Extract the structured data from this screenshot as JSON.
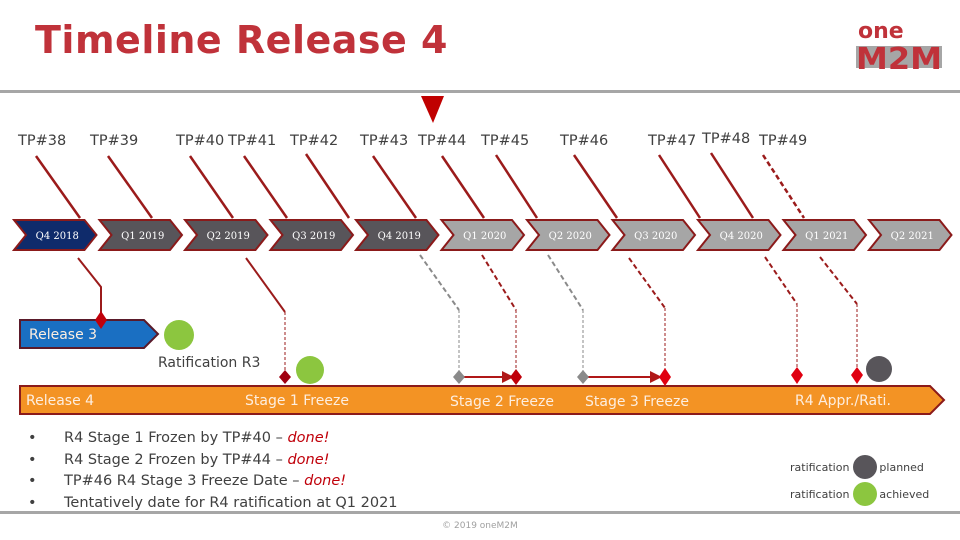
{
  "header": {
    "title": "Timeline Release 4",
    "logo_top": "one",
    "logo_bottom": "M2M"
  },
  "colors": {
    "title": "#c0323a",
    "chevron_past": "#58555a",
    "chevron_current": "#0f2b6b",
    "chevron_future": "#a6a6a6",
    "chevron_border": "#8b1a1a",
    "release3": "#1a6fc2",
    "release4": "#f39324",
    "achieved": "#8cc63f",
    "planned": "#58555a",
    "marker": "#c00000"
  },
  "current_marker": "TP#44",
  "tp_meetings": [
    "TP#38",
    "TP#39",
    "TP#40",
    "TP#41",
    "TP#42",
    "TP#43",
    "TP#44",
    "TP#45",
    "TP#46",
    "TP#47",
    "TP#48",
    "TP#49"
  ],
  "quarters": [
    {
      "label": "Q4 2018",
      "state": "current"
    },
    {
      "label": "Q1 2019",
      "state": "past"
    },
    {
      "label": "Q2 2019",
      "state": "past"
    },
    {
      "label": "Q3 2019",
      "state": "past"
    },
    {
      "label": "Q4 2019",
      "state": "past"
    },
    {
      "label": "Q1 2020",
      "state": "future"
    },
    {
      "label": "Q2 2020",
      "state": "future"
    },
    {
      "label": "Q3 2020",
      "state": "future"
    },
    {
      "label": "Q4 2020",
      "state": "future"
    },
    {
      "label": "Q1 2021",
      "state": "future"
    },
    {
      "label": "Q2 2021",
      "state": "future"
    }
  ],
  "release3": {
    "label": "Release 3",
    "ratification_label": "Ratification R3"
  },
  "release4": {
    "label": "Release 4",
    "milestones": [
      "Stage 1 Freeze",
      "Stage 2 Freeze",
      "Stage 3 Freeze",
      "R4 Appr./Rati."
    ]
  },
  "bullets": [
    {
      "text": "R4 Stage 1 Frozen by TP#40 – ",
      "status": "done!"
    },
    {
      "text": "R4 Stage 2 Frozen by TP#44 – ",
      "status": "done!"
    },
    {
      "text": "TP#46 R4 Stage 3 Freeze Date  – ",
      "status": "done!"
    },
    {
      "text": "Tentatively date for R4 ratification at Q1 2021",
      "status": ""
    }
  ],
  "legend": [
    {
      "left": "ratification",
      "right": "planned",
      "color": "#58555a"
    },
    {
      "left": "ratification",
      "right": "achieved",
      "color": "#8cc63f"
    }
  ],
  "footer": "© 2019 oneM2M"
}
